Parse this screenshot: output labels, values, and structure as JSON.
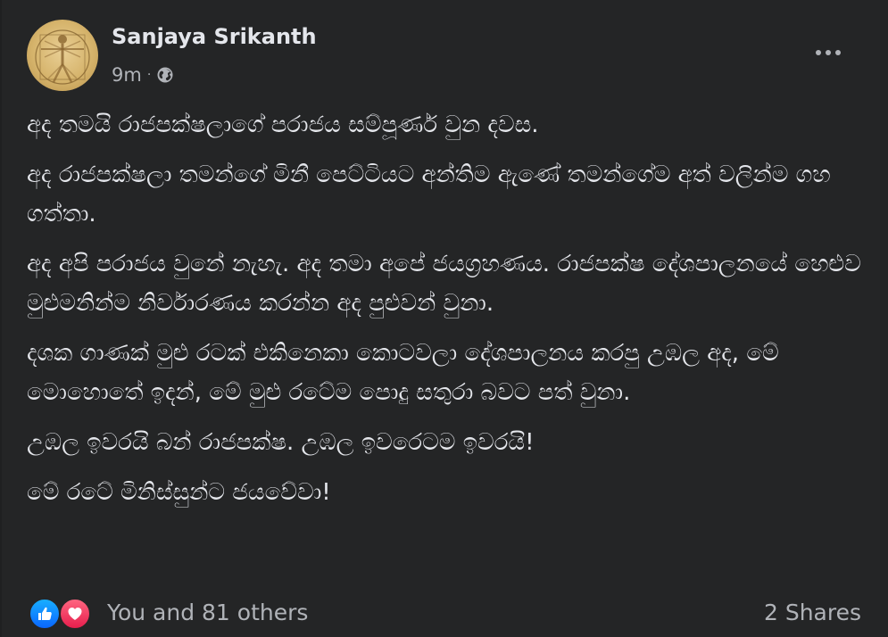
{
  "post": {
    "author": "Sanjaya Srikanth",
    "time": "9m",
    "separator": "·",
    "audience_icon": "globe-icon",
    "paragraphs": [
      "අද තමයි රාජපක්ෂලාගේ පරාජය සම්පූර්ණ වුන දවස.",
      "අද රාජපක්ෂලා තමන්ගේ මිනී පෙට්ටියට අන්තිම ඇණේ තමන්ගේම අත් වලින්ම ගහ ගත්තා.",
      "අද අපි පරාජය වුනේ නැහැ. අද තමා අපේ ජයග්‍රහණය. රාජපක්ෂ දේශපාලනයේ හෙළුව මුළුමනින්ම නිර්වාරණය කරන්න අද පුළුවන් වුනා.",
      "දශක ගාණක් මුළු රටක් එකිනෙකා කොටවලා දේශපාලනය කරපු උඹල අද, මේ මොහොතේ ඉදන්, මේ මුළු රටේම පොදු සතුරා බවට පත් වුනා.",
      "උඹල ඉවරයි බන් රාජපක්ෂ. උඹල ඉවරෙටම ඉවරයි!",
      "මේ රටේ මිනිස්සුන්ට ජයවේවා!"
    ]
  },
  "reactions": {
    "icons": [
      "like-icon",
      "love-icon"
    ],
    "text": "You and 81 others",
    "shares": "2 Shares",
    "like_color": "#1877f2",
    "love_color": "#f33e58"
  },
  "colors": {
    "background": "#242526",
    "primary_text": "#e4e6eb",
    "secondary_text": "#b0b3b8"
  }
}
